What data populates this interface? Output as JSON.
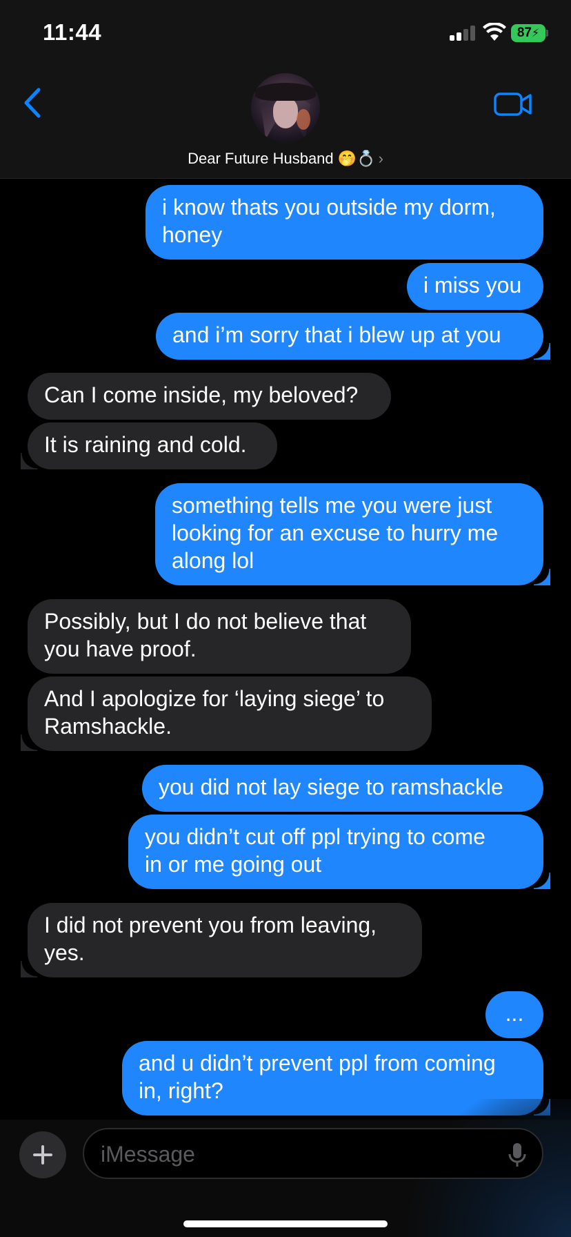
{
  "status_bar": {
    "time": "11:44",
    "battery": "87"
  },
  "header": {
    "contact_name": "Dear Future Husband",
    "contact_emoji": "🤭💍"
  },
  "colors": {
    "sent_bubble": "#1f86fe",
    "received_bubble": "#262628",
    "accent": "#0a84ff"
  },
  "messages": [
    {
      "from": "me",
      "text": "i know thats you outside my dorm,\nhoney"
    },
    {
      "from": "me",
      "text": "i miss you"
    },
    {
      "from": "me",
      "text": "and i’m sorry that i blew up at you"
    },
    {
      "from": "them",
      "text": "Can I come inside, my beloved?"
    },
    {
      "from": "them",
      "text": "It is raining and cold."
    },
    {
      "from": "me",
      "text": "something tells me you were just\nlooking for an excuse to hurry me\nalong lol"
    },
    {
      "from": "them",
      "text": "Possibly, but I do not believe that\nyou have proof."
    },
    {
      "from": "them",
      "text": "And I apologize for ‘laying siege’ to\nRamshackle."
    },
    {
      "from": "me",
      "text": "you did not lay siege to ramshackle"
    },
    {
      "from": "me",
      "text": "you didn’t cut off ppl trying to come\nin or me going out"
    },
    {
      "from": "them",
      "text": "I did not prevent you from leaving,\nyes."
    },
    {
      "from": "me",
      "text": "..."
    },
    {
      "from": "me",
      "text": "and u didn’t prevent ppl from coming\nin, right?"
    }
  ],
  "composer": {
    "placeholder": "iMessage"
  }
}
